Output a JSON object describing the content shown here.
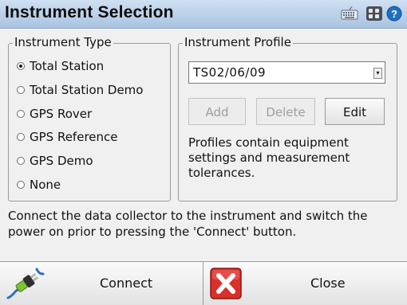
{
  "window": {
    "title": "Instrument Selection",
    "icons": [
      "keyboard-icon",
      "grid-icon",
      "help-icon"
    ]
  },
  "instrument_type": {
    "title": "Instrument Type",
    "options": [
      {
        "label": "Total Station",
        "selected": true
      },
      {
        "label": "Total Station Demo",
        "selected": false
      },
      {
        "label": "GPS Rover",
        "selected": false
      },
      {
        "label": "GPS Reference",
        "selected": false
      },
      {
        "label": "GPS Demo",
        "selected": false
      },
      {
        "label": "None",
        "selected": false
      }
    ]
  },
  "instrument_profile": {
    "title": "Instrument Profile",
    "selected_profile": "TS02/06/09",
    "buttons": {
      "add": "Add",
      "delete": "Delete",
      "edit": "Edit"
    },
    "note": "Profiles contain equipment settings and measurement tolerances."
  },
  "instructions": "Connect the data collector to the instrument and switch the power on prior to pressing the 'Connect' button.",
  "footer": {
    "connect_label": "Connect",
    "close_label": "Close"
  },
  "colors": {
    "titlebar": "#b9d0ea",
    "close_icon": "#d9302a",
    "help_icon": "#1e6fc4"
  }
}
